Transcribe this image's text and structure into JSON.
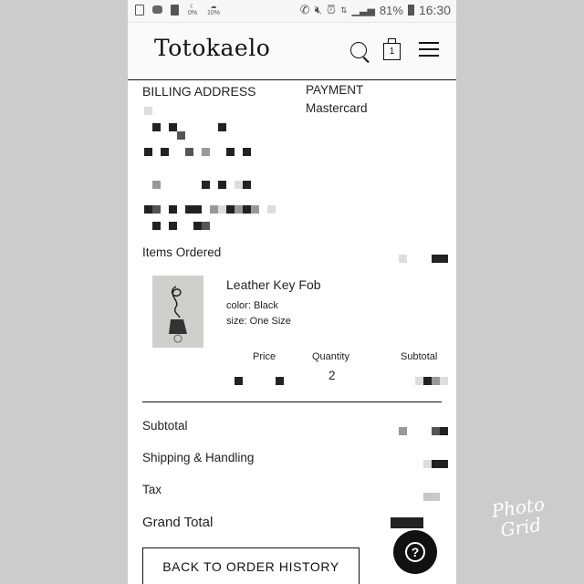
{
  "status_bar": {
    "left_icons": [
      "screenshot-icon",
      "media-icon",
      "battery-saver-icon",
      "weather-0-icon",
      "weather-10-icon"
    ],
    "weather_labels": [
      "0%",
      "10%"
    ],
    "right_icons": [
      "wifi-call-icon",
      "mute-icon",
      "alarm-icon",
      "data-icon",
      "signal-icon",
      "battery-icon"
    ],
    "battery": "81%",
    "time": "16:30"
  },
  "header": {
    "logo": "Totokaelo",
    "cart_count": "1"
  },
  "billing": {
    "title": "BILLING ADDRESS"
  },
  "payment": {
    "title": "PAYMENT",
    "method": "Mastercard"
  },
  "items_ordered": {
    "title": "Items Ordered",
    "items": [
      {
        "name": "Leather Key Fob",
        "color": "color: Black",
        "size": "size: One Size",
        "price_label": "Price",
        "quantity_label": "Quantity",
        "quantity": "2",
        "subtotal_label": "Subtotal"
      }
    ]
  },
  "totals": {
    "subtotal": "Subtotal",
    "shipping": "Shipping & Handling",
    "tax": "Tax",
    "grand_total": "Grand Total"
  },
  "actions": {
    "back": "BACK TO ORDER HISTORY",
    "help": "?"
  },
  "watermark": {
    "line1": "Photo",
    "line2": "Grid"
  }
}
